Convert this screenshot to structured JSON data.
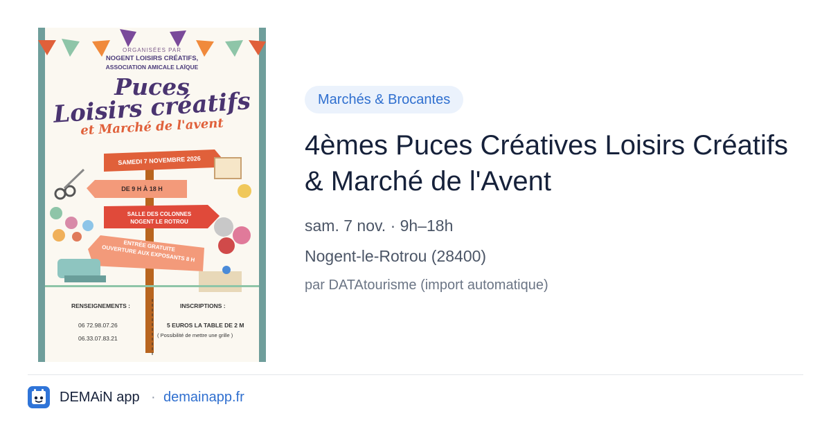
{
  "poster": {
    "organised_by": "ORGANISÉES PAR",
    "org_name": "NOGENT LOISIRS CRÉATIFS,",
    "org_assoc": "ASSOCIATION AMICALE LAÏQUE",
    "headline_1": "Puces",
    "headline_2": "Loisirs créatifs",
    "headline_3": "et Marché de l'avent",
    "sign_date": "SAMEDI 7 NOVEMBRE 2026",
    "sign_hours": "DE 9 H À 18 H",
    "sign_place_1": "SALLE DES COLONNES",
    "sign_place_2": "NOGENT LE ROTROU",
    "sign_entry_1": "ENTRÉE GRATUITE",
    "sign_entry_2": "OUVERTURE AUX EXPOSANTS 8 H",
    "info_label": "RENSEIGNEMENTS :",
    "phone_1": "06 72.98.07.26",
    "phone_2": "06.33.07.83.21",
    "registration_label": "INSCRIPTIONS :",
    "price": "5 EUROS LA TABLE DE 2 M",
    "price_note": "( Possibilité de mettre une grille )"
  },
  "event": {
    "category": "Marchés & Brocantes",
    "title": "4èmes Puces Créatives Loisirs Créatifs & Marché de l'Avent",
    "when": "sam. 7 nov. · 9h–18h",
    "where": "Nogent-le-Rotrou (28400)",
    "source": "par DATAtourisme (import automatique)"
  },
  "footer": {
    "app_name": "DEMAiN app",
    "separator": "·",
    "link": "demainapp.fr"
  },
  "colors": {
    "accent": "#2f6fcf",
    "tag_bg": "#ebf2fc",
    "title": "#16213a",
    "meta": "#4b5566"
  }
}
